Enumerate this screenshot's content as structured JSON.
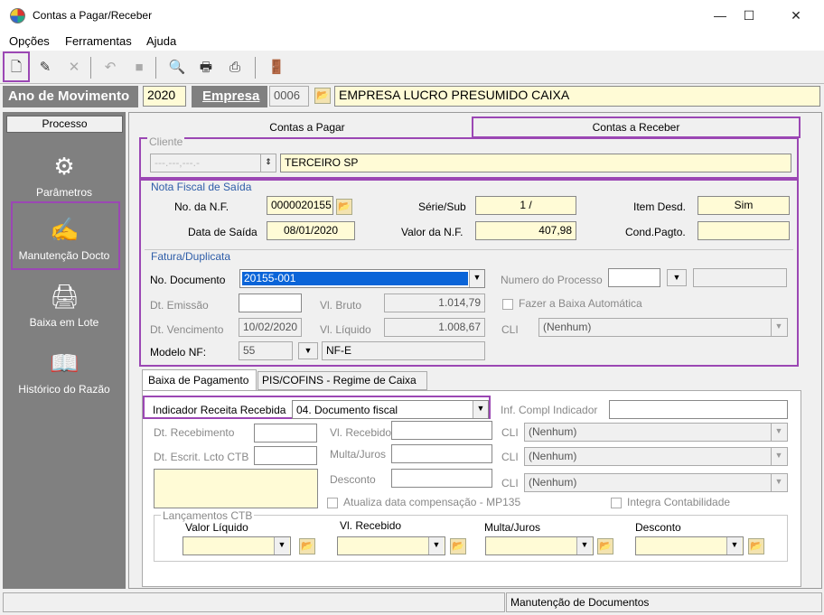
{
  "window": {
    "title": "Contas a Pagar/Receber",
    "minimize": "—",
    "maximize": "☐",
    "close": "✕"
  },
  "menu": {
    "opcoes": "Opções",
    "ferramentas": "Ferramentas",
    "ajuda": "Ajuda"
  },
  "header": {
    "ano_label": "Ano de Movimento",
    "ano_value": "2020",
    "empresa_label": "Empresa",
    "empresa_code": "0006",
    "empresa_name": "EMPRESA LUCRO PRESUMIDO CAIXA"
  },
  "sidebar": {
    "header": "Processo",
    "items": [
      {
        "label": "Parâmetros",
        "icon": "gears-icon"
      },
      {
        "label": "Manutenção Docto",
        "icon": "pen-writing-icon"
      },
      {
        "label": "Baixa em Lote",
        "icon": "printer-lot-icon"
      },
      {
        "label": "Histórico do Razão",
        "icon": "ledger-book-icon"
      }
    ]
  },
  "tabs_top": {
    "pagar": "Contas a Pagar",
    "receber": "Contas a Receber"
  },
  "cliente": {
    "title": "Cliente",
    "code": "---.---,---.-",
    "name": "TERCEIRO SP"
  },
  "nota_fiscal": {
    "title": "Nota Fiscal de Saída",
    "no_nf_label": "No. da N.F.",
    "no_nf": "0000020155",
    "serie_label": "Série/Sub",
    "serie": "1 /",
    "item_desd_label": "Item Desd.",
    "item_desd": "Sim",
    "data_saida_label": "Data de Saída",
    "data_saida": "08/01/2020",
    "valor_nf_label": "Valor da N.F.",
    "valor_nf": "407,98",
    "cond_pagto_label": "Cond.Pagto.",
    "cond_pagto": ""
  },
  "fatura": {
    "title": "Fatura/Duplicata",
    "no_doc_label": "No. Documento",
    "no_doc": "20155-001",
    "num_proc_label": "Numero do Processo",
    "dt_emissao_label": "Dt. Emissão",
    "vl_bruto_label": "Vl. Bruto",
    "vl_bruto": "1.014,79",
    "baixa_auto_label": "Fazer a Baixa Automática",
    "dt_venc_label": "Dt. Vencimento",
    "dt_venc": "10/02/2020",
    "vl_liquido_label": "Vl. Líquido",
    "vl_liquido": "1.008,67",
    "cli_label": "CLI",
    "cli_value": "(Nenhum)",
    "modelo_label": "Modelo NF:",
    "modelo": "55",
    "modelo_desc": "NF-E"
  },
  "tabs_bottom": {
    "baixa": "Baixa de Pagamento",
    "pis": "PIS/COFINS - Regime de Caixa"
  },
  "baixa": {
    "indicador_label": "Indicador Receita Recebida",
    "indicador_value": "04. Documento fiscal",
    "inf_compl_label": "Inf. Compl Indicador",
    "dt_receb_label": "Dt. Recebimento",
    "vl_receb_label": "Vl. Recebido",
    "cli_label": "CLI",
    "nenhum": "(Nenhum)",
    "dt_escrit_label": "Dt. Escrit. Lcto CTB",
    "multa_label": "Multa/Juros",
    "desconto_label": "Desconto",
    "atualiza_label": "Atualiza data compensação - MP135",
    "integra_label": "Integra Contabilidade",
    "lanc_title": "Lançamentos CTB",
    "lanc_cols": [
      "Valor Líquido",
      "Vl. Recebido",
      "Multa/Juros",
      "Desconto"
    ]
  },
  "status": {
    "message": "Manutenção de Documentos"
  },
  "colors": {
    "highlight": "#9b47b4",
    "yellow_field": "#fffbd6",
    "group_title": "#2e5da8",
    "selected": "#0a64d8"
  }
}
